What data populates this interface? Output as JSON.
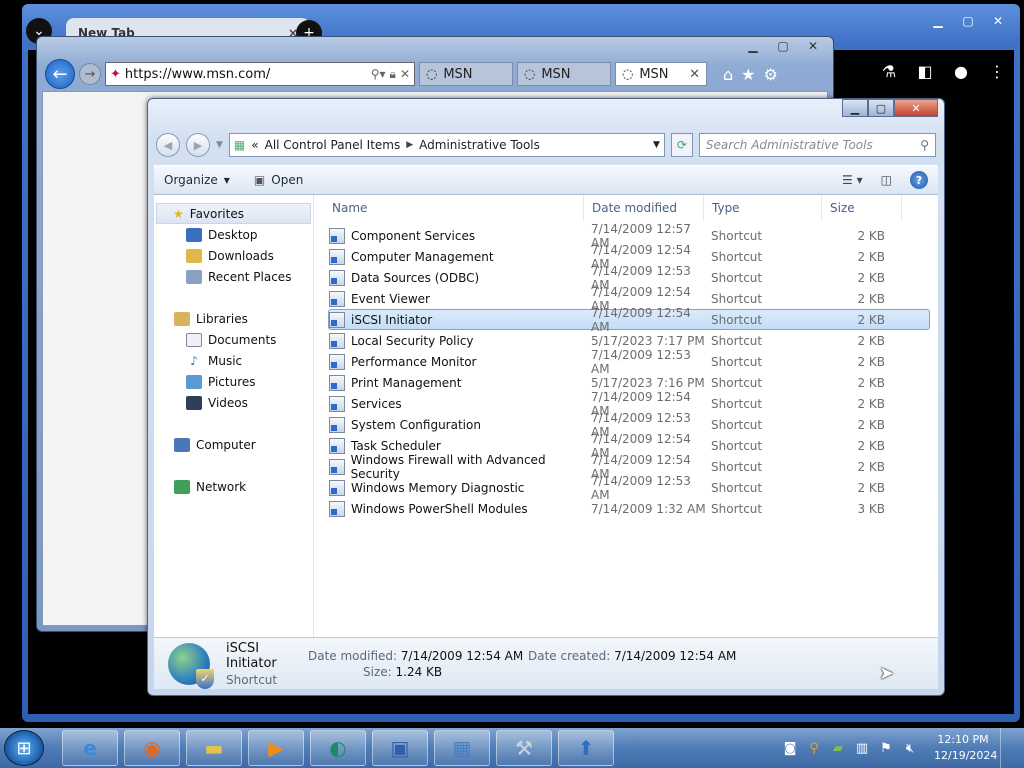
{
  "chrome": {
    "tab_title": "New Tab",
    "tab_close": "×",
    "new_tab": "+",
    "tab_search": "⌄"
  },
  "ie": {
    "address": "https://www.msn.com/",
    "tabs": [
      {
        "label": "MSN",
        "active": false
      },
      {
        "label": "MSN",
        "active": false
      },
      {
        "label": "MSN",
        "active": true
      }
    ]
  },
  "explorer": {
    "breadcrumb": [
      "All Control Panel Items",
      "Administrative Tools"
    ],
    "breadcrumb_prefix": "«",
    "search_placeholder": "Search Administrative Tools",
    "toolbar": {
      "organize": "Organize",
      "open": "Open"
    },
    "nav": {
      "favorites": "Favorites",
      "favorites_items": [
        "Desktop",
        "Downloads",
        "Recent Places"
      ],
      "libraries": "Libraries",
      "libraries_items": [
        "Documents",
        "Music",
        "Pictures",
        "Videos"
      ],
      "computer": "Computer",
      "network": "Network"
    },
    "columns": {
      "name": "Name",
      "date": "Date modified",
      "type": "Type",
      "size": "Size"
    },
    "files": [
      {
        "name": "Component Services",
        "date": "7/14/2009 12:57 AM",
        "type": "Shortcut",
        "size": "2 KB"
      },
      {
        "name": "Computer Management",
        "date": "7/14/2009 12:54 AM",
        "type": "Shortcut",
        "size": "2 KB"
      },
      {
        "name": "Data Sources (ODBC)",
        "date": "7/14/2009 12:53 AM",
        "type": "Shortcut",
        "size": "2 KB"
      },
      {
        "name": "Event Viewer",
        "date": "7/14/2009 12:54 AM",
        "type": "Shortcut",
        "size": "2 KB"
      },
      {
        "name": "iSCSI Initiator",
        "date": "7/14/2009 12:54 AM",
        "type": "Shortcut",
        "size": "2 KB",
        "selected": true
      },
      {
        "name": "Local Security Policy",
        "date": "5/17/2023 7:17 PM",
        "type": "Shortcut",
        "size": "2 KB"
      },
      {
        "name": "Performance Monitor",
        "date": "7/14/2009 12:53 AM",
        "type": "Shortcut",
        "size": "2 KB"
      },
      {
        "name": "Print Management",
        "date": "5/17/2023 7:16 PM",
        "type": "Shortcut",
        "size": "2 KB"
      },
      {
        "name": "Services",
        "date": "7/14/2009 12:54 AM",
        "type": "Shortcut",
        "size": "2 KB"
      },
      {
        "name": "System Configuration",
        "date": "7/14/2009 12:53 AM",
        "type": "Shortcut",
        "size": "2 KB"
      },
      {
        "name": "Task Scheduler",
        "date": "7/14/2009 12:54 AM",
        "type": "Shortcut",
        "size": "2 KB"
      },
      {
        "name": "Windows Firewall with Advanced Security",
        "date": "7/14/2009 12:54 AM",
        "type": "Shortcut",
        "size": "2 KB"
      },
      {
        "name": "Windows Memory Diagnostic",
        "date": "7/14/2009 12:53 AM",
        "type": "Shortcut",
        "size": "2 KB"
      },
      {
        "name": "Windows PowerShell Modules",
        "date": "7/14/2009 1:32 AM",
        "type": "Shortcut",
        "size": "3 KB"
      }
    ],
    "details": {
      "name": "iSCSI Initiator",
      "kind": "Shortcut",
      "modified_label": "Date modified:",
      "modified_value": "7/14/2009 12:54 AM",
      "created_label": "Date created:",
      "created_value": "7/14/2009 12:54 AM",
      "size_label": "Size:",
      "size_value": "1.24 KB"
    }
  },
  "taskbar": {
    "clock_time": "12:10 PM",
    "clock_date": "12/19/2024"
  },
  "colors": {
    "accent": "#3f72c6",
    "selection": "#c3dcf6",
    "taskbar": "#4f7cb5"
  }
}
